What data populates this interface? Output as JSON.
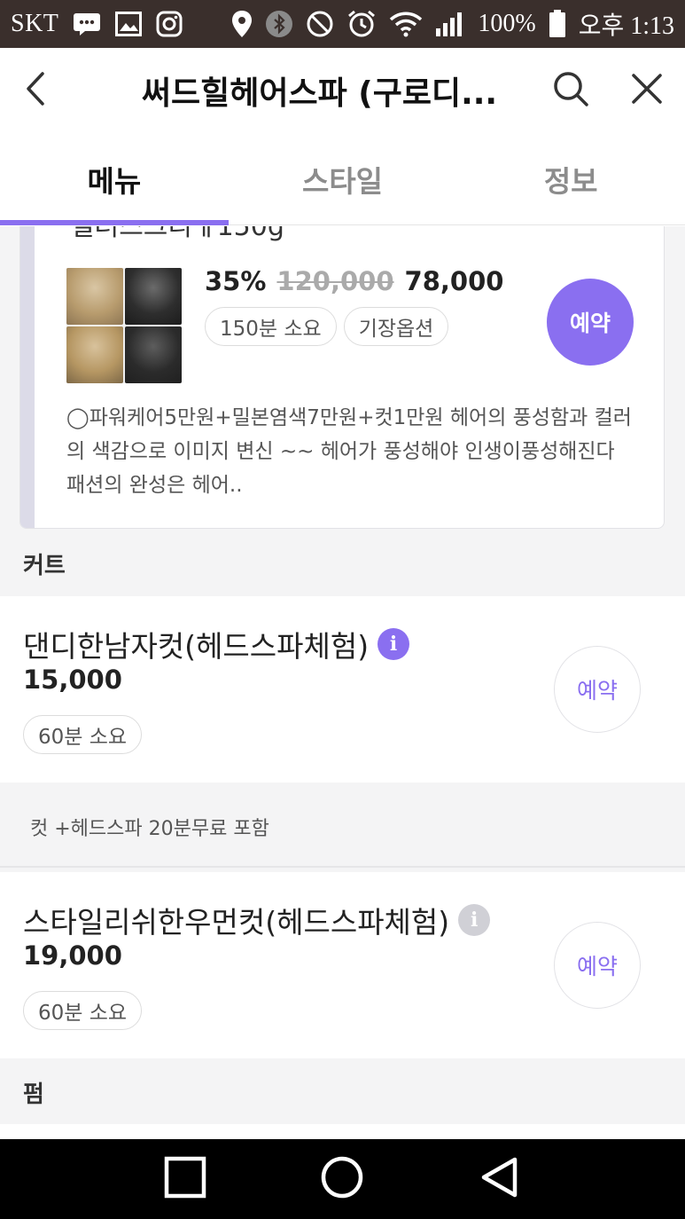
{
  "status_bar": {
    "carrier": "SKT",
    "battery": "100%",
    "time": "오후 1:13",
    "icons": [
      "message-icon",
      "gallery-icon",
      "instagram-icon",
      "location-icon",
      "bluetooth-icon",
      "mute-icon",
      "alarm-icon",
      "wifi-icon",
      "signal-icon",
      "battery-icon"
    ]
  },
  "header": {
    "title": "써드힐헤어스파 (구로디...",
    "back_icon": "back-chevron-icon",
    "search_icon": "search-icon",
    "close_icon": "close-icon"
  },
  "tabs": [
    {
      "label": "메뉴",
      "active": true
    },
    {
      "label": "스타일",
      "active": false
    },
    {
      "label": "정보",
      "active": false
    }
  ],
  "accent_color": "#8a6ff0",
  "featured": {
    "partial_title": "컬러스크리ㅔ150g",
    "discount": "35%",
    "original_price": "120,000",
    "final_price": "78,000",
    "chips": [
      "150분 소요",
      "기장옵션"
    ],
    "reserve_label": "예약",
    "description": "◯파워케어5만원+밀본염색7만원+컷1만원  헤어의 풍성함과 컬러의 색감으로 이미지 변신 ~~ 헤어가 풍성해야 인생이풍성해진다 패션의 완성은 헤어.."
  },
  "sections": {
    "cut": "커트",
    "perm": "펌"
  },
  "items": [
    {
      "name": "댄디한남자컷(헤드스파체험)",
      "price": "15,000",
      "duration": "60분 소요",
      "reserve_label": "예약",
      "note": "컷 +헤드스파 20분무료 포함"
    },
    {
      "name": "스타일리쉬한우먼컷(헤드스파체험)",
      "price": "19,000",
      "duration": "60분 소요",
      "reserve_label": "예약"
    }
  ],
  "nav": {
    "recents": "recents-square-icon",
    "home": "home-circle-icon",
    "back": "back-triangle-icon"
  }
}
